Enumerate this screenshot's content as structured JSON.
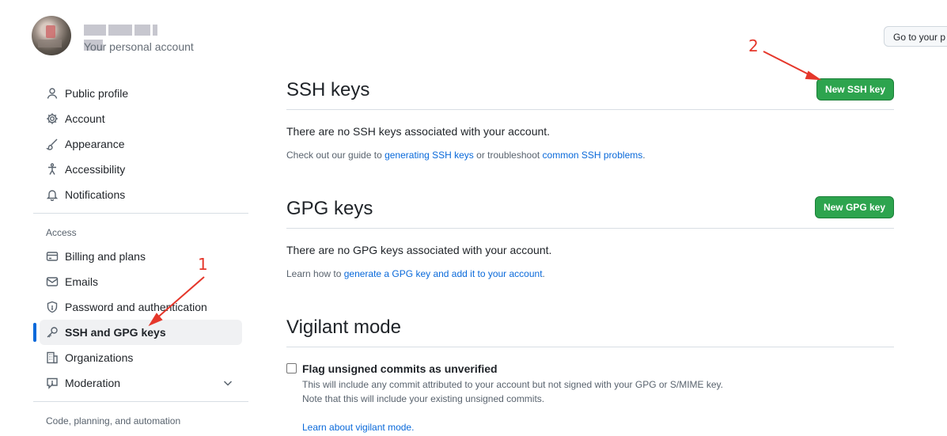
{
  "header": {
    "account_subtitle": "Your personal account",
    "goto_button": "Go to your p"
  },
  "sidebar": {
    "items_top": [
      {
        "label": "Public profile",
        "icon": "person-icon"
      },
      {
        "label": "Account",
        "icon": "gear-icon"
      },
      {
        "label": "Appearance",
        "icon": "paintbrush-icon"
      },
      {
        "label": "Accessibility",
        "icon": "accessibility-icon"
      },
      {
        "label": "Notifications",
        "icon": "bell-icon"
      }
    ],
    "access_label": "Access",
    "items_access": [
      {
        "label": "Billing and plans",
        "icon": "credit-card-icon"
      },
      {
        "label": "Emails",
        "icon": "mail-icon"
      },
      {
        "label": "Password and authentication",
        "icon": "shield-lock-icon"
      },
      {
        "label": "SSH and GPG keys",
        "icon": "key-icon",
        "active": true
      },
      {
        "label": "Organizations",
        "icon": "organization-icon"
      },
      {
        "label": "Moderation",
        "icon": "report-icon"
      }
    ],
    "code_label": "Code, planning, and automation"
  },
  "ssh": {
    "title": "SSH keys",
    "button": "New SSH key",
    "empty": "There are no SSH keys associated with your account.",
    "guide_prefix": "Check out our guide to ",
    "guide_link1": "generating SSH keys",
    "guide_mid": " or troubleshoot ",
    "guide_link2": "common SSH problems",
    "guide_suffix": "."
  },
  "gpg": {
    "title": "GPG keys",
    "button": "New GPG key",
    "empty": "There are no GPG keys associated with your account.",
    "learn_prefix": "Learn how to ",
    "learn_link": "generate a GPG key and add it to your account",
    "learn_suffix": "."
  },
  "vigilant": {
    "title": "Vigilant mode",
    "checkbox_label": "Flag unsigned commits as unverified",
    "note1": "This will include any commit attributed to your account but not signed with your GPG or S/MIME key.",
    "note2": "Note that this will include your existing unsigned commits.",
    "learn_link": "Learn about vigilant mode."
  },
  "annotations": {
    "step1": "1",
    "step2": "2",
    "color": "#e5372b"
  },
  "colors": {
    "accent": "#0969da",
    "primary_button": "#2da44e"
  }
}
